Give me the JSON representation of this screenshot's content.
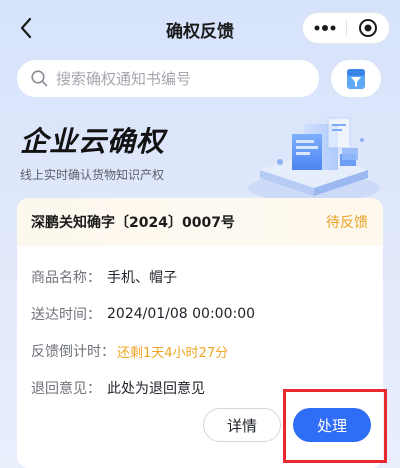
{
  "nav": {
    "title": "确权反馈",
    "more_label": "•••"
  },
  "search": {
    "placeholder": "搜索确权通知书编号"
  },
  "hero": {
    "title": "企业云确权",
    "subtitle": "线上实时确认货物知识产权"
  },
  "card": {
    "number": "深鹏关知确字〔2024〕0007号",
    "status": "待反馈",
    "rows": [
      {
        "label": "商品名称：",
        "value": "手机、帽子"
      },
      {
        "label": "送达时间：",
        "value": "2024/01/08 00:00:00"
      },
      {
        "label": "反馈倒计时：",
        "value": "还剩1天4小时27分"
      },
      {
        "label": "退回意见：",
        "value": "此处为退回意见"
      }
    ],
    "detail_button": "详情",
    "handle_button": "处理"
  },
  "colors": {
    "primary": "#2f6df6",
    "status_pending": "#e8a126",
    "countdown": "#f0a623",
    "highlight": "#e8292f"
  },
  "icons": {
    "back": "chevron-left-icon",
    "more": "more-dots-icon",
    "close": "target-circle-icon",
    "search": "search-icon",
    "filter": "filter-document-icon"
  }
}
